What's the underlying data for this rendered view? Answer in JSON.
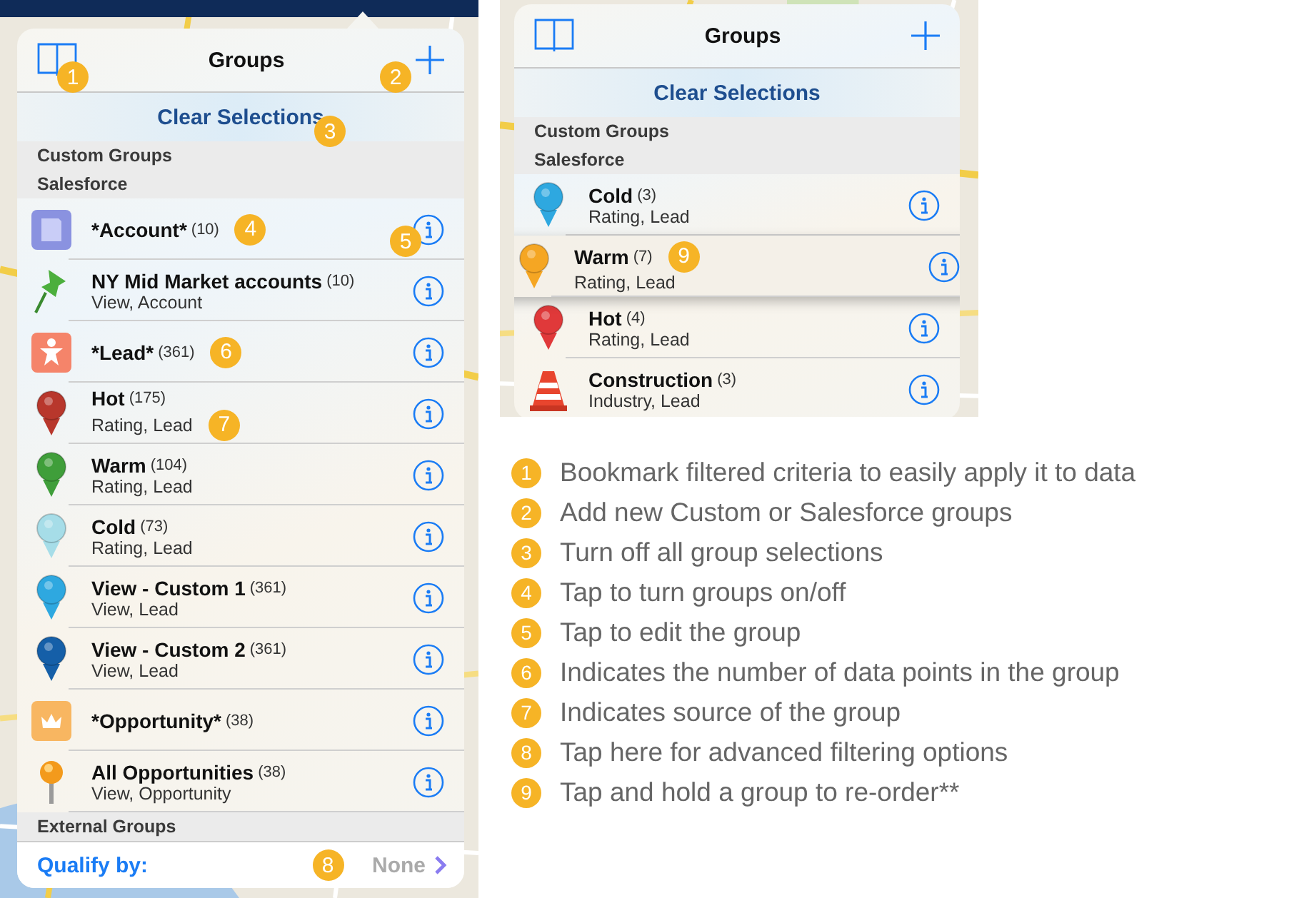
{
  "main_screen": {
    "header": {
      "title": "Groups",
      "bookmark_callout": "1",
      "add_callout": "2"
    },
    "clear": {
      "label": "Clear Selections",
      "callout": "3"
    },
    "section_headers": [
      "Custom Groups",
      "Salesforce"
    ],
    "rows": [
      {
        "kind": "folder",
        "name": "*Account*",
        "count": "(10)",
        "name_callout": "4",
        "info_callout": "5"
      },
      {
        "kind": "thumbtack",
        "name": "NY Mid Market accounts",
        "count": "(10)",
        "source": "View, Account"
      },
      {
        "kind": "person",
        "name": "*Lead*",
        "count": "(361)",
        "name_callout": "6"
      },
      {
        "kind": "pin",
        "color": "#b8372c",
        "name": "Hot",
        "count": "(175)",
        "source": "Rating, Lead",
        "source_callout": "7"
      },
      {
        "kind": "pin",
        "color": "#3f9e3a",
        "name": "Warm",
        "count": "(104)",
        "source": "Rating, Lead"
      },
      {
        "kind": "pin",
        "color": "#a6dde8",
        "name": "Cold",
        "count": "(73)",
        "source": "Rating, Lead"
      },
      {
        "kind": "pin",
        "color": "#2ea8e0",
        "name": "View - Custom 1",
        "count": "(361)",
        "source": "View, Lead"
      },
      {
        "kind": "pin",
        "color": "#155fa8",
        "name": "View - Custom 2",
        "count": "(361)",
        "source": "View, Lead"
      },
      {
        "kind": "crown",
        "name": "*Opportunity*",
        "count": "(38)"
      },
      {
        "kind": "ball-pin",
        "name": "All Opportunities",
        "count": "(38)",
        "source": "View, Opportunity"
      }
    ],
    "footer_header": "External Groups",
    "qualify_by": {
      "label": "Qualify by:",
      "value": "None",
      "callout": "8"
    }
  },
  "reorder_screen": {
    "header": {
      "title": "Groups"
    },
    "clear": {
      "label": "Clear Selections"
    },
    "section_headers": [
      "Custom Groups",
      "Salesforce"
    ],
    "rows": [
      {
        "kind": "pin",
        "color": "#2ea8e0",
        "name": "Cold",
        "count": "(3)",
        "source": "Rating, Lead",
        "dragging": false
      },
      {
        "kind": "pin",
        "color": "#f5a623",
        "name": "Warm",
        "count": "(7)",
        "source": "Rating, Lead",
        "dragging": true,
        "name_callout": "9"
      },
      {
        "kind": "pin",
        "color": "#e0393a",
        "name": "Hot",
        "count": "(4)",
        "source": "Rating, Lead",
        "dragging": false
      },
      {
        "kind": "cone",
        "name": "Construction",
        "count": "(3)",
        "source": "Industry, Lead",
        "dragging": false
      }
    ]
  },
  "legend": [
    {
      "number": "1",
      "text": "Bookmark filtered criteria to easily apply it to data"
    },
    {
      "number": "2",
      "text": "Add new Custom or Salesforce groups"
    },
    {
      "number": "3",
      "text": "Turn off all group selections"
    },
    {
      "number": "4",
      "text": "Tap to turn groups on/off"
    },
    {
      "number": "5",
      "text": "Tap to edit the group"
    },
    {
      "number": "6",
      "text": "Indicates the number of data points in the group"
    },
    {
      "number": "7",
      "text": "Indicates source of the group"
    },
    {
      "number": "8",
      "text": "Tap here for advanced filtering options"
    },
    {
      "number": "9",
      "text": "Tap and hold a group to re-order**"
    }
  ]
}
